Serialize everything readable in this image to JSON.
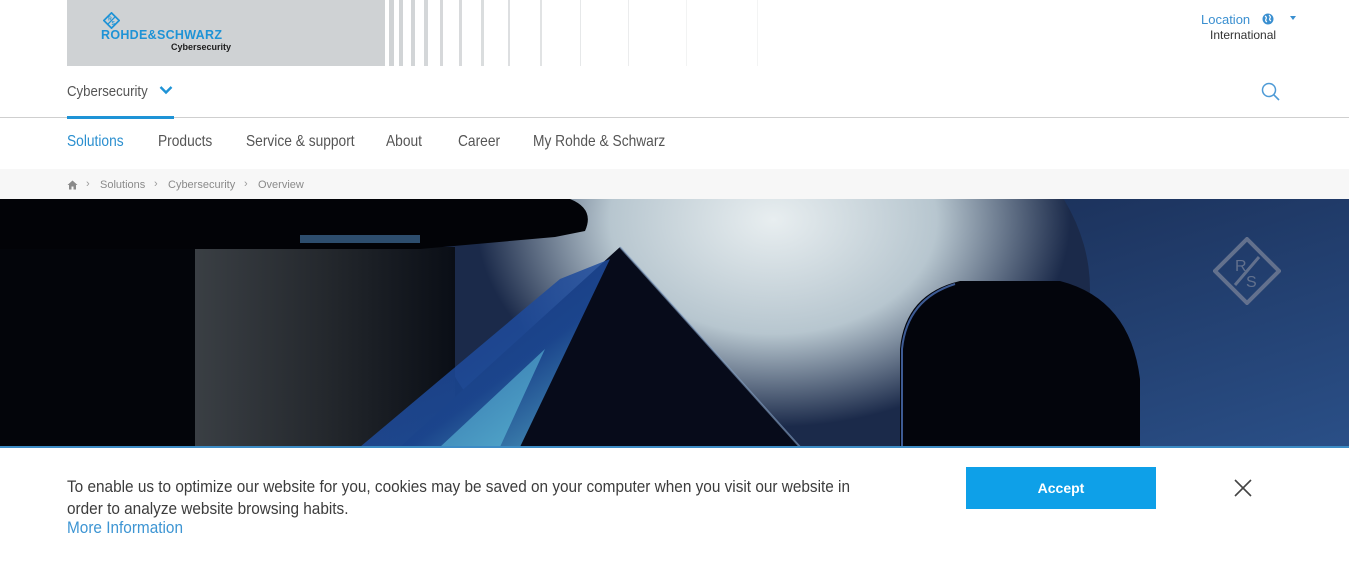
{
  "brand": {
    "name": "ROHDE&SCHWARZ",
    "sub": "Cybersecurity",
    "color": "#1e93d6"
  },
  "location": {
    "label": "Location",
    "value": "International",
    "icon": "globe-icon"
  },
  "section": {
    "label": "Cybersecurity",
    "icon": "chevron-down-icon"
  },
  "search": {
    "icon": "search-icon"
  },
  "nav": {
    "items": [
      {
        "label": "Solutions",
        "active": true
      },
      {
        "label": "Products",
        "active": false
      },
      {
        "label": "Service & support",
        "active": false
      },
      {
        "label": "About",
        "active": false
      },
      {
        "label": "Career",
        "active": false
      },
      {
        "label": "My Rohde & Schwarz",
        "active": false
      }
    ]
  },
  "breadcrumb": {
    "home_icon": "home-icon",
    "separator": "›",
    "items": [
      "Solutions",
      "Cybersecurity",
      "Overview"
    ]
  },
  "hero": {
    "watermark": "R&S diamond logo"
  },
  "cookie": {
    "text": "To enable us to optimize our website for you, cookies may be saved on your computer when you visit our website in order to analyze website browsing habits.",
    "more_info": "More Information",
    "accept_label": "Accept",
    "close_icon": "close-icon",
    "accent": "#0ea0e8"
  }
}
